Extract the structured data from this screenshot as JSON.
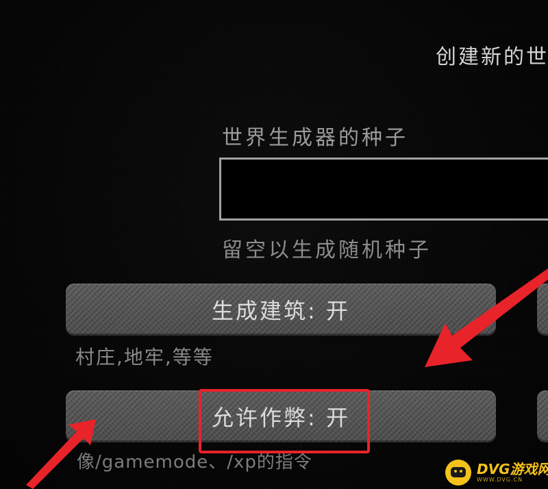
{
  "screen": {
    "title": "创建新的世"
  },
  "seed": {
    "label": "世界生成器的种子",
    "value": "",
    "placeholder": "",
    "hint": "留空以生成随机种子"
  },
  "structures": {
    "button_label": "生成建筑: 开",
    "description": "村庄,地牢,等等"
  },
  "cheats": {
    "button_label": "允许作弊: 开",
    "description": "像/gamemode、/xp的指令"
  },
  "watermark": {
    "name": "DVG游戏网",
    "url": "WWW.DVG.CN"
  },
  "colors": {
    "highlight": "#e8232a",
    "watermark": "#f4c21a",
    "button": "#575757"
  }
}
